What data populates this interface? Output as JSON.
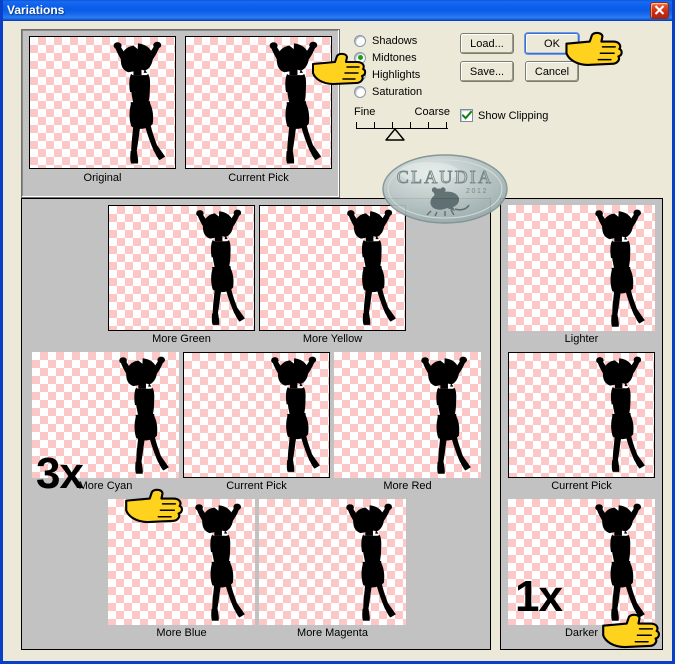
{
  "window": {
    "title": "Variations",
    "close_icon": "close-icon"
  },
  "top_previews": [
    {
      "label": "Original",
      "tint": "original"
    },
    {
      "label": "Current Pick",
      "tint": "cyan"
    }
  ],
  "controls": {
    "radios": [
      {
        "label": "Shadows",
        "checked": false
      },
      {
        "label": "Midtones",
        "checked": true
      },
      {
        "label": "Highlights",
        "checked": false
      },
      {
        "label": "Saturation",
        "checked": false
      }
    ],
    "slider": {
      "min_label": "Fine",
      "max_label": "Coarse",
      "ticks": 6,
      "position": 2
    },
    "buttons": [
      {
        "label": "Load...",
        "focused": false
      },
      {
        "label": "OK",
        "focused": true
      },
      {
        "label": "Save...",
        "focused": false
      },
      {
        "label": "Cancel",
        "focused": false
      }
    ],
    "checkbox": {
      "label": "Show Clipping",
      "checked": true,
      "check_icon": "checkmark-icon"
    }
  },
  "watermark": {
    "name": "CLAUDIA",
    "year": "2012",
    "icon": "mouse-icon"
  },
  "grid": {
    "cells": [
      {
        "label": "More Green",
        "tint": "green",
        "highlight": false,
        "row": 0,
        "col": 1
      },
      {
        "label": "More Yellow",
        "tint": "yellow",
        "highlight": false,
        "row": 0,
        "col": 2
      },
      {
        "label": "More Cyan",
        "tint": "cyan",
        "highlight": false,
        "row": 1,
        "col": 0
      },
      {
        "label": "Current Pick",
        "tint": "cyan",
        "highlight": true,
        "row": 1,
        "col": 1
      },
      {
        "label": "More Red",
        "tint": "red",
        "highlight": false,
        "row": 1,
        "col": 2
      },
      {
        "label": "More Blue",
        "tint": "blue",
        "highlight": false,
        "row": 2,
        "col": 1
      },
      {
        "label": "More Magenta",
        "tint": "magenta",
        "highlight": false,
        "row": 2,
        "col": 2
      }
    ]
  },
  "right_column": {
    "cells": [
      {
        "label": "Lighter",
        "tint": "lighter",
        "highlight": false
      },
      {
        "label": "Current Pick",
        "tint": "cyan",
        "highlight": true
      },
      {
        "label": "Darker",
        "tint": "darker",
        "highlight": false
      }
    ]
  },
  "annotations": [
    {
      "text": "3x",
      "target": "More Cyan",
      "icon": "pointing-hand-icon"
    },
    {
      "text": "1x",
      "target": "Darker",
      "icon": "pointing-hand-icon"
    }
  ],
  "cursors": [
    {
      "icon": "pointing-hand-icon",
      "near": "Current Pick top preview"
    },
    {
      "icon": "pointing-hand-icon",
      "near": "OK button"
    },
    {
      "icon": "pointing-hand-icon",
      "near": "More Cyan"
    },
    {
      "icon": "pointing-hand-icon",
      "near": "Darker"
    }
  ],
  "colors": {
    "titlebar_blue": "#0d62ee",
    "dialog_bg": "#ece9d8",
    "panel_gray": "#c2c2c2",
    "checker_pink": "#fbc7c7",
    "close_red": "#c92b10",
    "radio_green": "#17a017",
    "hand_yellow": "#ffd21e"
  }
}
